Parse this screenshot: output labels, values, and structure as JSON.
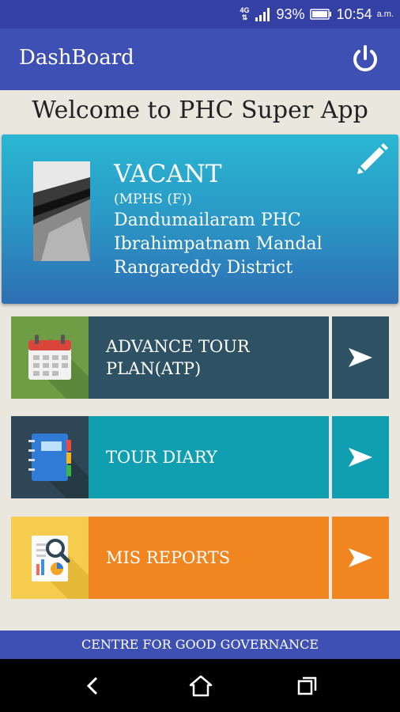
{
  "status_bar": {
    "network": "4G",
    "battery": "93%",
    "time": "10:54",
    "ampm": "a.m."
  },
  "app_bar": {
    "title": "DashBoard",
    "power_icon": "power-icon"
  },
  "welcome": "Welcome to PHC Super App",
  "profile": {
    "name": "VACANT",
    "designation": "(MPHS (F))",
    "phc": "Dandumailaram PHC",
    "mandal": "Ibrahimpatnam Mandal",
    "district": "Rangareddy District"
  },
  "menu": [
    {
      "label": "ADVANCE TOUR PLAN(ATP)",
      "icon": "calendar-icon",
      "icon_bg": "#6f9c45",
      "label_bg": "#2e5264",
      "arrow_bg": "#2e5264"
    },
    {
      "label": "TOUR DIARY",
      "icon": "notebook-icon",
      "icon_bg": "#2e4655",
      "label_bg": "#0f9fb0",
      "arrow_bg": "#0f9fb0"
    },
    {
      "label": "MIS REPORTS",
      "icon": "report-search-icon",
      "icon_bg": "#f6cc4e",
      "label_bg": "#f18620",
      "arrow_bg": "#f18620"
    }
  ],
  "footer": "CENTRE FOR GOOD GOVERNANCE"
}
